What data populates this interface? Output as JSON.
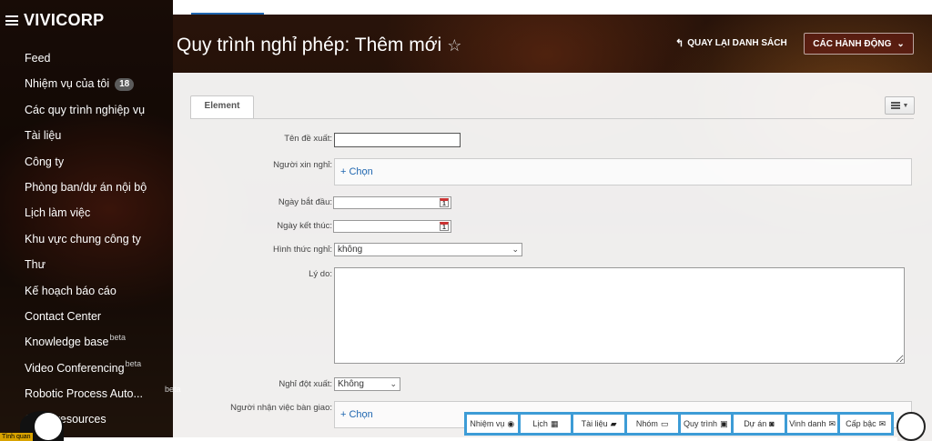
{
  "app": {
    "brand": "VIVICORP"
  },
  "sidebar": {
    "items": [
      {
        "label": "Feed"
      },
      {
        "label": "Nhiệm vụ của tôi",
        "badge": "18"
      },
      {
        "label": "Các quy trình nghiệp vụ"
      },
      {
        "label": "Tài liệu"
      },
      {
        "label": "Công ty"
      },
      {
        "label": "Phòng ban/dự án nội bộ"
      },
      {
        "label": "Lịch làm việc"
      },
      {
        "label": "Khu vực chung công ty"
      },
      {
        "label": "Thư"
      },
      {
        "label": "Kế hoạch báo cáo"
      },
      {
        "label": "Contact Center"
      },
      {
        "label": "Knowledge base",
        "beta": "beta"
      },
      {
        "label": "Video Conferencing",
        "beta": "beta"
      },
      {
        "label": "Robotic Process Auto...",
        "beta": "beta"
      },
      {
        "label": "Other resources"
      }
    ]
  },
  "header": {
    "title": "Quy trình nghỉ phép: Thêm mới",
    "back_label": "QUAY LẠI DANH SÁCH",
    "actions_label": "CÁC HÀNH ĐỘNG"
  },
  "form": {
    "tab_label": "Element",
    "fields": {
      "proposal_name": {
        "label": "Tên đề xuất:",
        "value": ""
      },
      "requester": {
        "label": "Người xin nghỉ:",
        "picker": "+ Chọn"
      },
      "start_date": {
        "label": "Ngày bắt đầu:",
        "value": ""
      },
      "end_date": {
        "label": "Ngày kết thúc:",
        "value": ""
      },
      "leave_type": {
        "label": "Hình thức nghỉ:",
        "value": "không"
      },
      "reason": {
        "label": "Lý do:",
        "value": ""
      },
      "sudden_leave": {
        "label": "Nghỉ đột xuất:",
        "value": "Không"
      },
      "handover": {
        "label": "Người nhận việc bàn giao:",
        "picker": "+ Chọn"
      }
    },
    "calendar_glyph": "1"
  },
  "dock": {
    "items": [
      {
        "label": "Nhiệm vụ",
        "icon": "task-icon"
      },
      {
        "label": "Lịch",
        "icon": "calendar-icon"
      },
      {
        "label": "Tài liệu",
        "icon": "folder-icon"
      },
      {
        "label": "Nhóm",
        "icon": "chat-icon"
      },
      {
        "label": "Quy trình",
        "icon": "process-icon"
      },
      {
        "label": "Dự án",
        "icon": "project-icon"
      },
      {
        "label": "Vinh danh",
        "icon": "honor-icon"
      },
      {
        "label": "Cấp bậc",
        "icon": "mail-icon"
      }
    ]
  },
  "status": {
    "tag": "Tình quan"
  },
  "colors": {
    "accent": "#2067b0",
    "dock": "#3d9cd6",
    "status": "#d9a300"
  }
}
